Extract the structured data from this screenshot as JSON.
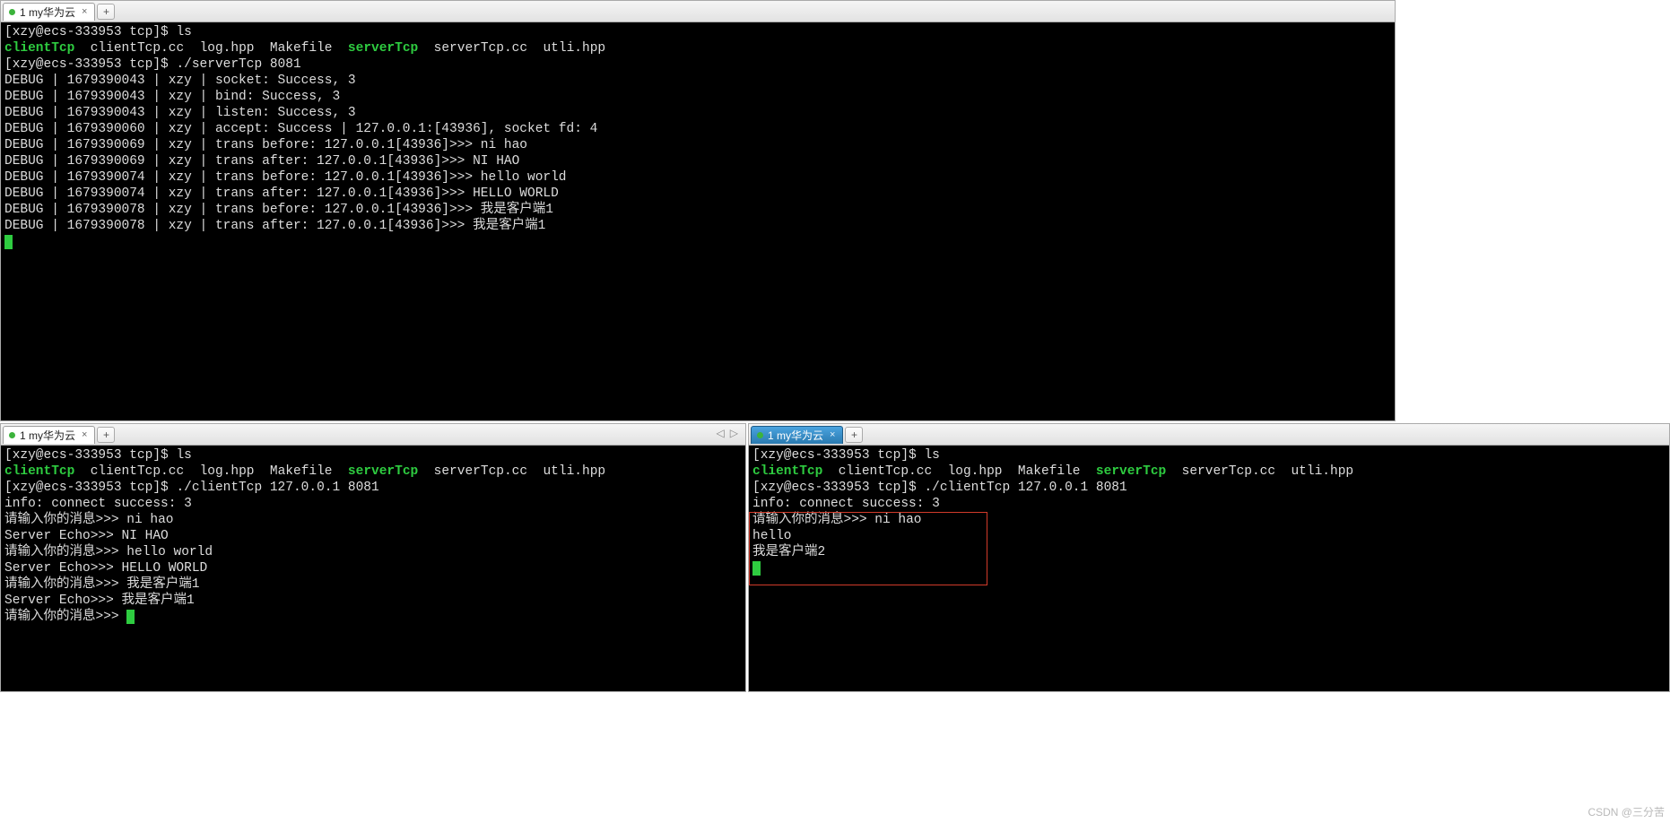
{
  "tabs": {
    "top": {
      "title": "1 my华为云"
    },
    "bl": {
      "title": "1 my华为云"
    },
    "br": {
      "title": "1 my华为云"
    }
  },
  "prompt": "[xzy@ecs-333953 tcp]$ ",
  "files": {
    "clientTcp": "clientTcp",
    "clientTcp_cc": "clientTcp.cc",
    "log_hpp": "log.hpp",
    "Makefile": "Makefile",
    "serverTcp": "serverTcp",
    "serverTcp_cc": "serverTcp.cc",
    "utli_hpp": "utli.hpp"
  },
  "top": {
    "cmd1": "ls",
    "cmd2": "./serverTcp 8081",
    "lines": {
      "l1": "DEBUG | 1679390043 | xzy | socket: Success, 3",
      "l2": "DEBUG | 1679390043 | xzy | bind: Success, 3",
      "l3": "DEBUG | 1679390043 | xzy | listen: Success, 3",
      "l4": "DEBUG | 1679390060 | xzy | accept: Success | 127.0.0.1:[43936], socket fd: 4",
      "l5": "DEBUG | 1679390069 | xzy | trans before: 127.0.0.1[43936]>>> ni hao",
      "l6": "DEBUG | 1679390069 | xzy | trans after: 127.0.0.1[43936]>>> NI HAO",
      "l7": "DEBUG | 1679390074 | xzy | trans before: 127.0.0.1[43936]>>> hello world",
      "l8": "DEBUG | 1679390074 | xzy | trans after: 127.0.0.1[43936]>>> HELLO WORLD",
      "l9": "DEBUG | 1679390078 | xzy | trans before: 127.0.0.1[43936]>>> 我是客户端1",
      "l10": "DEBUG | 1679390078 | xzy | trans after: 127.0.0.1[43936]>>> 我是客户端1"
    }
  },
  "bl": {
    "cmd1": "ls",
    "cmd2": "./clientTcp 127.0.0.1 8081",
    "lines": {
      "l1": "info: connect success: 3",
      "l2": "请输入你的消息>>> ni hao",
      "l3": "Server Echo>>> NI HAO",
      "l4": "请输入你的消息>>> hello world",
      "l5": "Server Echo>>> HELLO WORLD",
      "l6": "请输入你的消息>>> 我是客户端1",
      "l7": "Server Echo>>> 我是客户端1",
      "l8": "请输入你的消息>>> "
    }
  },
  "br": {
    "cmd1": "ls",
    "cmd2": "./clientTcp 127.0.0.1 8081",
    "lines": {
      "l1": "info: connect success: 3",
      "l2": "请输入你的消息>>> ni hao",
      "l3": "hello",
      "l4": "我是客户端2"
    }
  },
  "watermark": "CSDN @三分苦"
}
